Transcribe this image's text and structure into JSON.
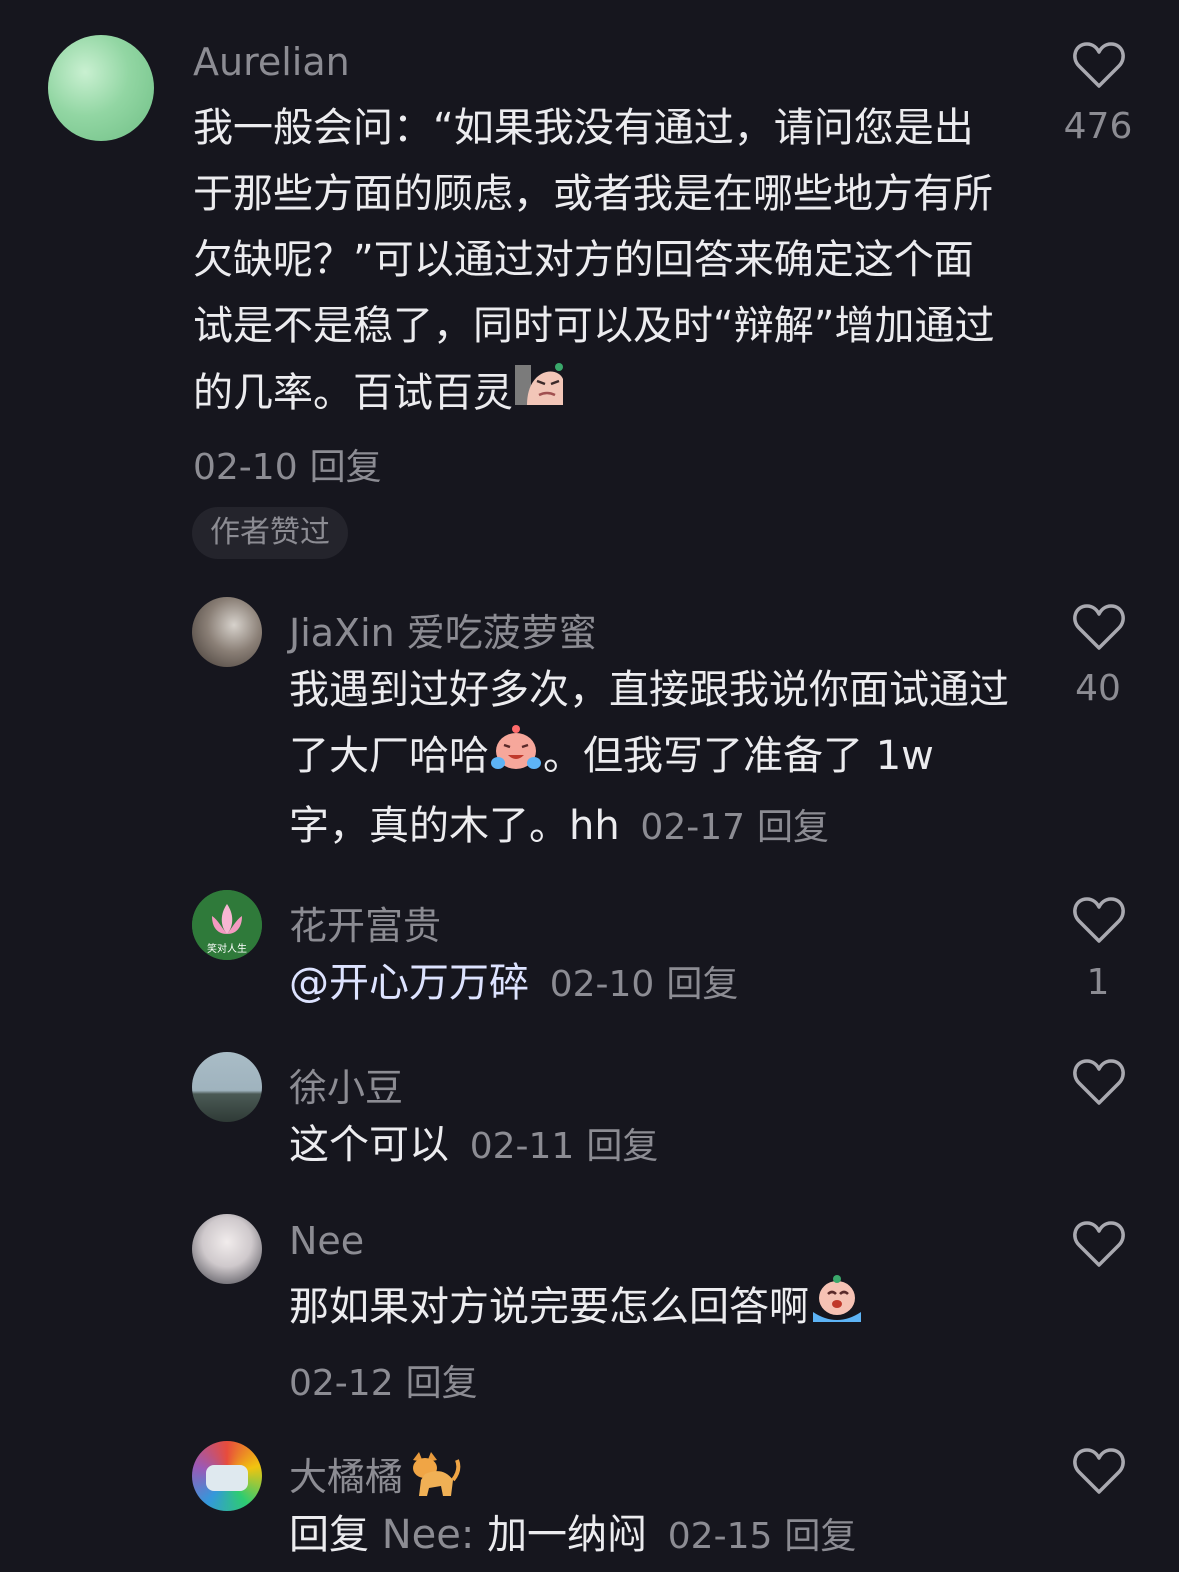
{
  "comments": [
    {
      "author": "Aurelian",
      "text": "我一般会问：“如果我没有通过，请问您是出于那些方面的顾虑，或者我是在哪些地方有所欠缺呢？”可以通过对方的回答来确定这个面试是不是稳了，同时可以及时“辩解”增加通过的几率。百试百灵",
      "date": "02-10",
      "reply_label": "回复",
      "likes": "476",
      "badge": "作者赞过",
      "avatar_color": "#8fd4a0"
    },
    {
      "author": "JiaXin 爱吃菠萝蜜",
      "text": "我遇到过好多次，直接跟我说你面试通过了大厂哈哈",
      "text2": "。但我写了准备了 1w 字，真的木了。hh",
      "date": "02-17",
      "reply_label": "回复",
      "likes": "40",
      "avatar_color": "#5a5048"
    },
    {
      "author": "花开富贵",
      "mention": "@开心万万碎",
      "date": "02-10",
      "reply_label": "回复",
      "likes": "1",
      "avatar_text": "笑对人生",
      "avatar_color": "#2f7a3a"
    },
    {
      "author": "徐小豆",
      "text": "这个可以",
      "date": "02-11",
      "reply_label": "回复",
      "likes": "",
      "avatar_color": "#6f7f86"
    },
    {
      "author": "Nee",
      "text": "那如果对方说完要怎么回答啊",
      "date": "02-12",
      "reply_label": "回复",
      "likes": "",
      "avatar_color": "#d8d8dc"
    },
    {
      "author": "大橘橘",
      "reply_prefix": "回复",
      "reply_target": "Nee:",
      "text": "加一纳闷",
      "date": "02-15",
      "reply_label": "回复",
      "likes": "",
      "avatar_color": "#4fa6d8"
    }
  ],
  "colors": {
    "background": "#16161e",
    "muted": "#8c8c93",
    "text": "#ececef"
  }
}
